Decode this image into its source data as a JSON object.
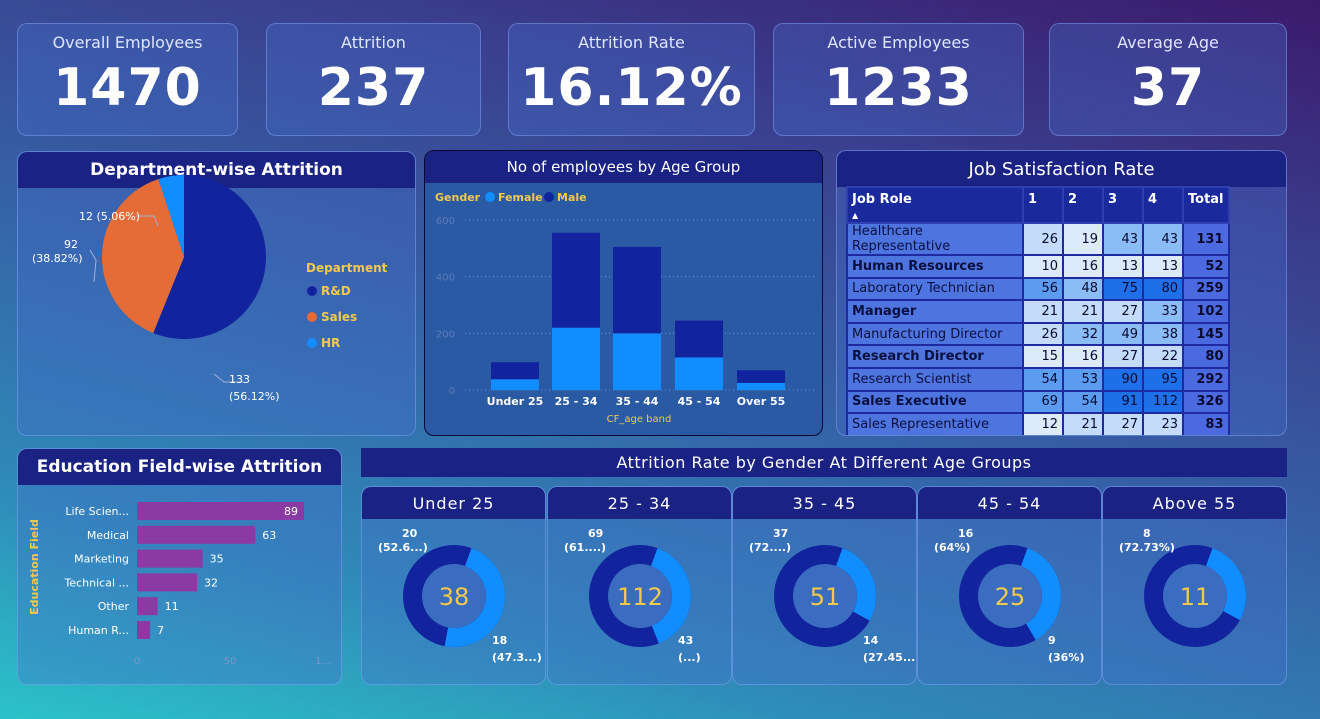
{
  "kpis": [
    {
      "title": "Overall Employees",
      "value": "1470"
    },
    {
      "title": "Attrition",
      "value": "237"
    },
    {
      "title": "Attrition Rate",
      "value": "16.12%"
    },
    {
      "title": "Active Employees",
      "value": "1233"
    },
    {
      "title": "Average Age",
      "value": "37"
    }
  ],
  "department": {
    "title": "Department-wise Attrition",
    "legend_title": "Department",
    "legend": [
      {
        "name": "R&D",
        "color": "#12239e"
      },
      {
        "name": "Sales",
        "color": "#e66c37"
      },
      {
        "name": "HR",
        "color": "#118dff"
      }
    ],
    "labels": {
      "hr": "12 (5.06%)",
      "sales_1": "92",
      "sales_2": "(38.82%)",
      "rd_1": "133",
      "rd_2": "(56.12%)"
    }
  },
  "age_group": {
    "title": "No of employees by Age Group",
    "legend_title": "Gender",
    "legend": [
      {
        "name": "Female",
        "color": "#118dff"
      },
      {
        "name": "Male",
        "color": "#12239e"
      }
    ],
    "xlabel": "CF_age band",
    "y_ticks": [
      "600",
      "400",
      "200",
      "0"
    ]
  },
  "job_satisfaction": {
    "title": "Job Satisfaction Rate",
    "headers": [
      "Job Role",
      "1",
      "2",
      "3",
      "4",
      "Total"
    ],
    "rows": [
      {
        "role": "Healthcare Representative",
        "v": [
          "26",
          "19",
          "43",
          "43"
        ],
        "total": "131",
        "bold": false
      },
      {
        "role": "Human Resources",
        "v": [
          "10",
          "16",
          "13",
          "13"
        ],
        "total": "52",
        "bold": true
      },
      {
        "role": "Laboratory Technician",
        "v": [
          "56",
          "48",
          "75",
          "80"
        ],
        "total": "259",
        "bold": false
      },
      {
        "role": "Manager",
        "v": [
          "21",
          "21",
          "27",
          "33"
        ],
        "total": "102",
        "bold": true
      },
      {
        "role": "Manufacturing Director",
        "v": [
          "26",
          "32",
          "49",
          "38"
        ],
        "total": "145",
        "bold": false
      },
      {
        "role": "Research Director",
        "v": [
          "15",
          "16",
          "27",
          "22"
        ],
        "total": "80",
        "bold": true
      },
      {
        "role": "Research Scientist",
        "v": [
          "54",
          "53",
          "90",
          "95"
        ],
        "total": "292",
        "bold": false
      },
      {
        "role": "Sales Executive",
        "v": [
          "69",
          "54",
          "91",
          "112"
        ],
        "total": "326",
        "bold": true
      },
      {
        "role": "Sales Representative",
        "v": [
          "12",
          "21",
          "27",
          "23"
        ],
        "total": "83",
        "bold": false
      }
    ]
  },
  "education": {
    "title": "Education Field-wise Attrition",
    "ylabel": "Education Field",
    "x_ticks": [
      "0",
      "50",
      "1..."
    ]
  },
  "gender_age": {
    "title": "Attrition Rate by Gender At Different Age Groups",
    "groups": [
      {
        "title": "Under 25",
        "center": "38",
        "top_1": "20",
        "top_2": "(52.6...)",
        "bot_1": "18",
        "bot_2": "(47.3...)",
        "female_frac": 0.4737
      },
      {
        "title": "25 - 34",
        "center": "112",
        "top_1": "69",
        "top_2": "(61....)",
        "bot_1": "43",
        "bot_2": "(...)",
        "female_frac": 0.384
      },
      {
        "title": "35 - 45",
        "center": "51",
        "top_1": "37",
        "top_2": "(72....)",
        "bot_1": "14",
        "bot_2": "(27.45...)",
        "female_frac": 0.2745
      },
      {
        "title": "45 - 54",
        "center": "25",
        "top_1": "16",
        "top_2": "(64%)",
        "bot_1": "9",
        "bot_2": "(36%)",
        "female_frac": 0.36
      },
      {
        "title": "Above 55",
        "center": "11",
        "top_1": "8",
        "top_2": "(72.73%)",
        "bot_1": "",
        "bot_2": "",
        "female_frac": 0.2727
      }
    ]
  },
  "chart_data": [
    {
      "type": "pie",
      "title": "Department-wise Attrition",
      "categories": [
        "R&D",
        "Sales",
        "HR"
      ],
      "values": [
        133,
        92,
        12
      ]
    },
    {
      "type": "bar",
      "stacked": true,
      "title": "No of employees by Age Group",
      "categories": [
        "Under 25",
        "25 - 34",
        "35 - 44",
        "45 - 54",
        "Over 55"
      ],
      "series": [
        {
          "name": "Female",
          "values": [
            38,
            220,
            200,
            115,
            25
          ]
        },
        {
          "name": "Male",
          "values": [
            60,
            335,
            305,
            130,
            45
          ]
        }
      ],
      "xlabel": "CF_age band",
      "ylim": [
        0,
        600
      ],
      "grid": true
    },
    {
      "type": "bar",
      "orientation": "horizontal",
      "title": "Education Field-wise Attrition",
      "categories": [
        "Life Scien...",
        "Medical",
        "Marketing",
        "Technical ...",
        "Other",
        "Human R..."
      ],
      "values": [
        89,
        63,
        35,
        32,
        11,
        7
      ],
      "ylabel": "Education Field",
      "xlim": [
        0,
        100
      ]
    }
  ]
}
